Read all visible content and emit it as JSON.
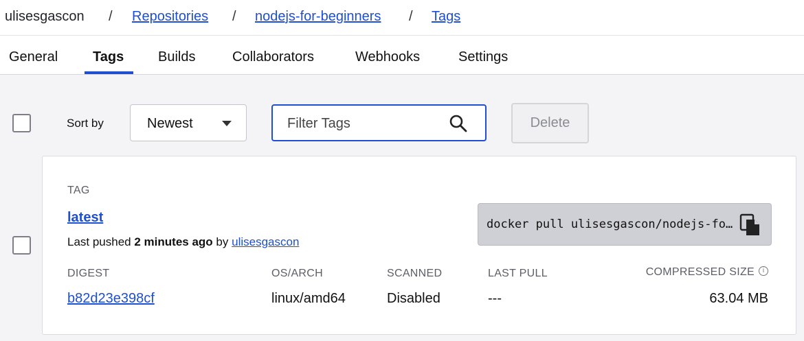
{
  "breadcrumb": {
    "user": "ulisesgascon",
    "separator": "/",
    "repositories": "Repositories",
    "repo": "nodejs-for-beginners",
    "tags": "Tags"
  },
  "tabs": [
    {
      "label": "General",
      "active": false
    },
    {
      "label": "Tags",
      "active": true
    },
    {
      "label": "Builds",
      "active": false
    },
    {
      "label": "Collaborators",
      "active": false
    },
    {
      "label": "Webhooks",
      "active": false
    },
    {
      "label": "Settings",
      "active": false
    }
  ],
  "toolbar": {
    "sort_label": "Sort by",
    "sort_value": "Newest",
    "filter_placeholder": "Filter Tags",
    "delete_label": "Delete"
  },
  "tag_card": {
    "section_label": "TAG",
    "tag_name": "latest",
    "pushed_prefix": "Last pushed",
    "pushed_time": "2 minutes ago",
    "pushed_by_word": "by",
    "pushed_by_user": "ulisesgascon",
    "pull_command": "docker pull ulisesgascon/nodejs-for-beginners:latest",
    "columns": {
      "digest": {
        "header": "DIGEST",
        "value": "b82d23e398cf"
      },
      "os_arch": {
        "header": "OS/ARCH",
        "value": "linux/amd64"
      },
      "scanned": {
        "header": "SCANNED",
        "value": "Disabled"
      },
      "last_pull": {
        "header": "LAST PULL",
        "value": "---"
      },
      "compressed_size": {
        "header": "COMPRESSED SIZE",
        "value": "63.04 MB"
      }
    }
  },
  "colors": {
    "link": "#1f4fd1",
    "active_tab_underline": "#1f4fd1"
  }
}
